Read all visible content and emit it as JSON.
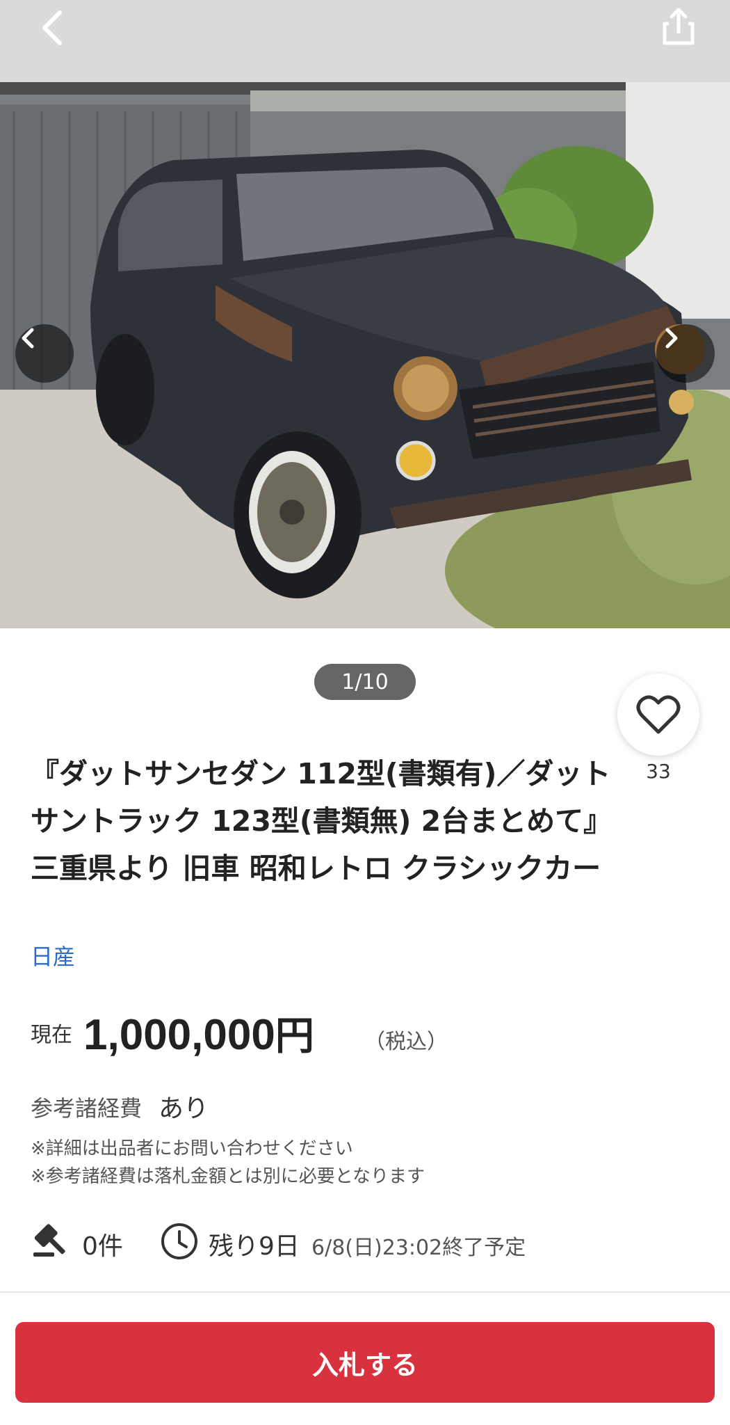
{
  "photo": {
    "counter": "1/10"
  },
  "favorite": {
    "count": "33"
  },
  "listing": {
    "title": "『ダットサンセダン 112型(書類有)／ダットサントラック 123型(書類無) 2台まとめて』三重県より 旧車 昭和レトロ クラシックカー",
    "brand": "日産"
  },
  "price": {
    "label": "現在",
    "amount": "1,000,000",
    "unit": "円",
    "tax": "（税込）"
  },
  "fees": {
    "label": "参考諸経費",
    "value": "あり",
    "note1": "※詳細は出品者にお問い合わせください",
    "note2": "※参考諸経費は落札金額とは別に必要となります"
  },
  "stats": {
    "bids": "0件",
    "remaining": "残り9日",
    "end_time": "6/8(日)23:02終了予定"
  },
  "actions": {
    "bid_label": "入札する"
  },
  "icons": {
    "back": "chevron-left-icon",
    "share": "share-icon",
    "prev": "chevron-left-icon",
    "next": "chevron-right-icon",
    "favorite": "heart-icon",
    "bids": "gavel-icon",
    "time": "clock-icon"
  },
  "colors": {
    "accent": "#d9323f",
    "link": "#2b6cc4"
  }
}
